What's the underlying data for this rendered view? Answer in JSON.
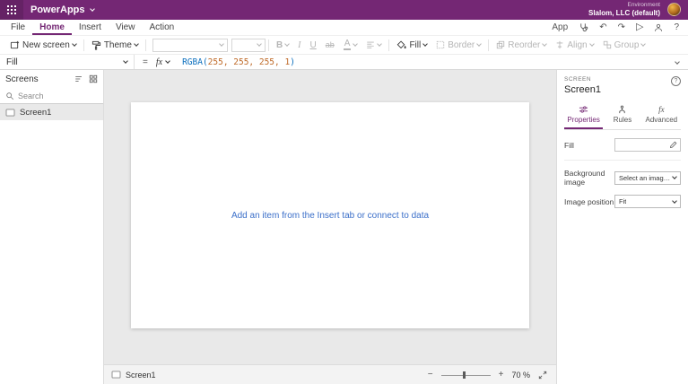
{
  "colors": {
    "brand": "#742774",
    "formula_function": "#0a6ebd",
    "formula_number": "#bf6a28",
    "canvas_link": "#3b6fc9"
  },
  "topbar": {
    "app_name": "PowerApps",
    "environment_label": "Environment",
    "environment_value": "Slalom, LLC (default)"
  },
  "menubar": {
    "tabs": [
      "File",
      "Home",
      "Insert",
      "View",
      "Action"
    ],
    "active_tab": "Home",
    "app_label": "App"
  },
  "ribbon": {
    "new_screen_label": "New screen",
    "theme_label": "Theme",
    "bold_label": "B",
    "italic_label": "I",
    "underline_label": "U",
    "strike_label": "ab",
    "font_color_label": "A",
    "fill_label": "Fill",
    "border_label": "Border",
    "reorder_label": "Reorder",
    "align_label": "Align",
    "group_label": "Group"
  },
  "formula_bar": {
    "property": "Fill",
    "equals": "=",
    "fx_label": "fx",
    "func_open": "RGBA(",
    "args": "255, 255, 255, 1",
    "func_close": ")"
  },
  "screens_panel": {
    "title": "Screens",
    "search_placeholder": "Search",
    "items": [
      {
        "label": "Screen1"
      }
    ]
  },
  "canvas": {
    "placeholder": "Add an item from the Insert tab or connect to data"
  },
  "properties_panel": {
    "type_label": "SCREEN",
    "title": "Screen1",
    "tabs": [
      "Properties",
      "Rules",
      "Advanced"
    ],
    "active_tab": "Properties",
    "fill_row_label": "Fill",
    "background_image_label": "Background image",
    "background_image_value": "Select an image...",
    "image_position_label": "Image position",
    "image_position_value": "Fit"
  },
  "statusbar": {
    "screen_label": "Screen1",
    "zoom_label": "70 %"
  },
  "icons": {
    "undo": "↶",
    "redo": "↷",
    "play": "▷",
    "help": "?",
    "panel_info": "?",
    "minus": "−",
    "plus": "+"
  }
}
